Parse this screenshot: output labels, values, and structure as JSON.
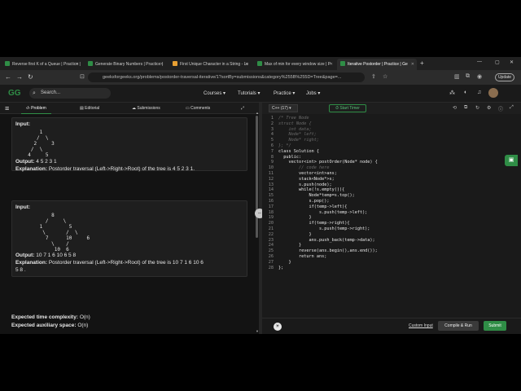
{
  "browser": {
    "tabs": [
      {
        "label": "Reverse first K of a Queue | Practice |",
        "active": false
      },
      {
        "label": "Generate Binary Numbers | Practice |",
        "active": false
      },
      {
        "label": "First Unique Character in a String - Le",
        "active": false
      },
      {
        "label": "Max of min for every window size | P",
        "active": false
      },
      {
        "label": "Iterative Postorder | Practice | Ge",
        "active": true
      }
    ],
    "new_tab": "+",
    "url": "geeksforgeeks.org/problems/postorder-traversal-iterative/1?sortBy=submissions&category%255B%255D=Tree&page=...",
    "update_label": "Update"
  },
  "header": {
    "logo": "GG",
    "search_placeholder": "Search...",
    "menus": [
      "Courses",
      "Tutorials",
      "Practice",
      "Jobs"
    ]
  },
  "panel_tabs": [
    "Problem",
    "Editorial",
    "Submissions",
    "Comments"
  ],
  "examples": [
    {
      "input_label": "Input:",
      "tree": "      1\n     /  \\\n    2     3\n   /  \\\n  4     5",
      "output_label": "Output:",
      "output_value": "4 5 2 3 1",
      "explanation_label": "Explanation:",
      "explanation_lines": [
        "Postorder traversal (Left->Right->Root) of the tree is 4 5 2 3 1."
      ]
    },
    {
      "input_label": "Input:",
      "tree": "          8\n        /     \\\n      1         5\n       \\       /  \\\n        7      10     6\n          \\    /\n           10  6",
      "output_label": "Output:",
      "output_value": "10 7 1 6 10 6 5 8",
      "explanation_label": "Explanation:",
      "explanation_lines": [
        "Postorder traversal (Left->Right->Root) of the tree is 10 7 1 6 10 6",
        "5 8 ."
      ]
    }
  ],
  "complexity": {
    "time_label": "Expected time complexity:",
    "time_value": "O(n)",
    "space_label": "Expected auxiliary space:",
    "space_value": "O(n)"
  },
  "editor": {
    "language": "C++ (17)",
    "timer_label": "Start Timer",
    "lines": [
      {
        "n": "1",
        "t": "/* Tree Node",
        "c": "cm"
      },
      {
        "n": "2",
        "t": "struct Node {",
        "c": "cm"
      },
      {
        "n": "3",
        "t": "    int data;",
        "c": "cm"
      },
      {
        "n": "4",
        "t": "    Node* left;",
        "c": "cm"
      },
      {
        "n": "5",
        "t": "    Node* right;",
        "c": "cm"
      },
      {
        "n": "6",
        "t": "}; */",
        "c": "cm"
      },
      {
        "n": "7",
        "t": "class Solution {",
        "c": "cd"
      },
      {
        "n": "8",
        "t": "  public:",
        "c": "cd"
      },
      {
        "n": "9",
        "t": "    vector<int> postOrder(Node* node) {",
        "c": "cd"
      },
      {
        "n": "10",
        "t": "        // code here",
        "c": "cm"
      },
      {
        "n": "11",
        "t": "        vector<int>ans;",
        "c": "cd"
      },
      {
        "n": "12",
        "t": "        stack<Node*>s;",
        "c": "cd"
      },
      {
        "n": "13",
        "t": "        s.push(node);",
        "c": "cd"
      },
      {
        "n": "14",
        "t": "        while(!s.empty()){",
        "c": "cd"
      },
      {
        "n": "15",
        "t": "            Node*temp=s.top();",
        "c": "cd"
      },
      {
        "n": "16",
        "t": "            s.pop();",
        "c": "cd"
      },
      {
        "n": "17",
        "t": "            if(temp->left){",
        "c": "cd"
      },
      {
        "n": "18",
        "t": "                s.push(temp->left);",
        "c": "cd"
      },
      {
        "n": "19",
        "t": "            }",
        "c": "cd"
      },
      {
        "n": "20",
        "t": "            if(temp->right){",
        "c": "cd"
      },
      {
        "n": "21",
        "t": "                s.push(temp->right);",
        "c": "cd"
      },
      {
        "n": "22",
        "t": "            }",
        "c": "cd"
      },
      {
        "n": "23",
        "t": "            ans.push_back(temp->data);",
        "c": "cd"
      },
      {
        "n": "24",
        "t": "        }",
        "c": "cd"
      },
      {
        "n": "25",
        "t": "        reverse(ans.begin(),ans.end());",
        "c": "cd"
      },
      {
        "n": "26",
        "t": "        return ans;",
        "c": "cd"
      },
      {
        "n": "27",
        "t": "    }",
        "c": "cd"
      },
      {
        "n": "28",
        "t": "};",
        "c": "cd"
      }
    ],
    "custom_input": "Custom Input",
    "compile_label": "Compile & Run",
    "submit_label": "Submit"
  },
  "colors": {
    "accent": "#2f8d46",
    "background": "#131313",
    "panel": "#1e1e1e"
  }
}
